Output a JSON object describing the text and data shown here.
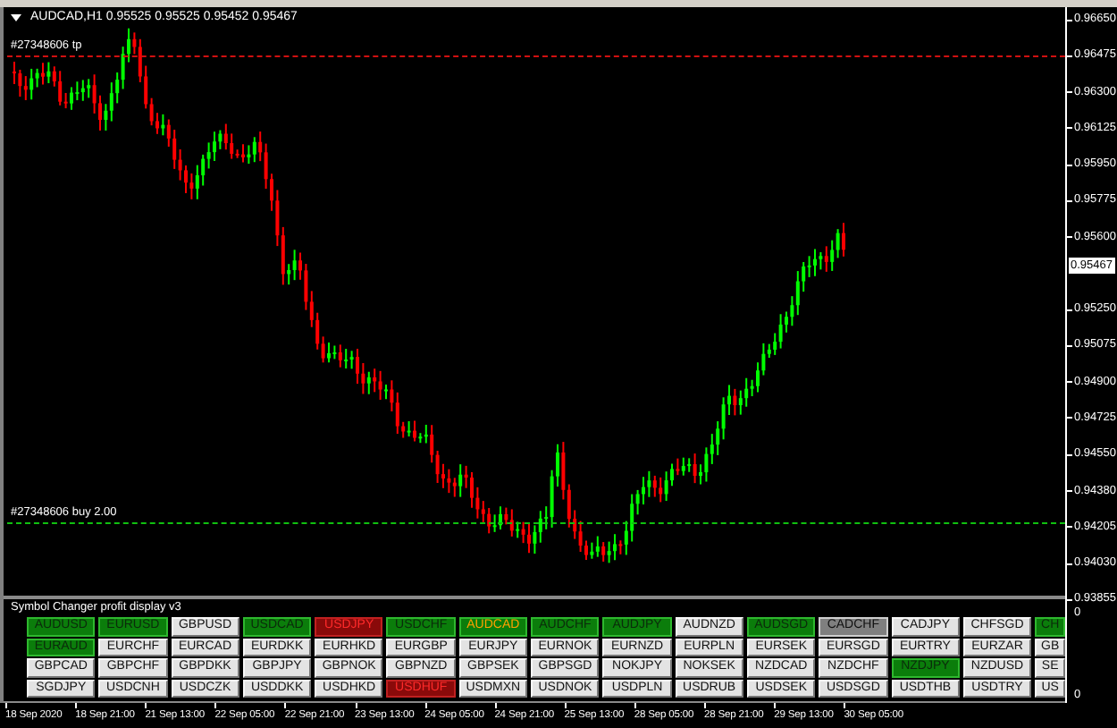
{
  "chart": {
    "title": "AUDCAD,H1  0.95525 0.95525 0.95452 0.95467",
    "orders": [
      {
        "kind": "tp",
        "label": "#27348606 tp"
      },
      {
        "kind": "entry",
        "label": "#27348606 buy 2.00"
      }
    ]
  },
  "price_axis": [
    {
      "kind": "tick",
      "label": "0.96650"
    },
    {
      "kind": "tick",
      "label": "0.96475"
    },
    {
      "kind": "tick",
      "label": "0.96300"
    },
    {
      "kind": "tick",
      "label": "0.96125"
    },
    {
      "kind": "tick",
      "label": "0.95950"
    },
    {
      "kind": "tick",
      "label": "0.95775"
    },
    {
      "kind": "tick",
      "label": "0.95600"
    },
    {
      "kind": "price",
      "label": "0.95467"
    },
    {
      "kind": "tick",
      "label": "0.95250"
    },
    {
      "kind": "tick",
      "label": "0.95075"
    },
    {
      "kind": "tick",
      "label": "0.94900"
    },
    {
      "kind": "tick",
      "label": "0.94725"
    },
    {
      "kind": "tick",
      "label": "0.94550"
    },
    {
      "kind": "tick",
      "label": "0.94380"
    },
    {
      "kind": "tick",
      "label": "0.94205"
    },
    {
      "kind": "tick",
      "label": "0.94030"
    },
    {
      "kind": "tick",
      "label": "0.93855"
    }
  ],
  "indicator": {
    "title": "Symbol Changer profit display v3",
    "axis": [
      "0",
      "0"
    ],
    "rows": [
      {
        "buttons": [
          {
            "symbol": "AUDUSD",
            "kind": "profit",
            "selected": false
          },
          {
            "symbol": "EURUSD",
            "kind": "profit",
            "selected": false
          },
          {
            "symbol": "GBPUSD",
            "kind": "flat",
            "selected": false
          },
          {
            "symbol": "USDCAD",
            "kind": "profit",
            "selected": false
          },
          {
            "symbol": "USDJPY",
            "kind": "loss",
            "selected": false
          },
          {
            "symbol": "USDCHF",
            "kind": "profit",
            "selected": false
          },
          {
            "symbol": "AUDCAD",
            "kind": "profit",
            "selected": true
          },
          {
            "symbol": "AUDCHF",
            "kind": "profit",
            "selected": false
          },
          {
            "symbol": "AUDJPY",
            "kind": "profit",
            "selected": false
          },
          {
            "symbol": "AUDNZD",
            "kind": "flat",
            "selected": false
          },
          {
            "symbol": "AUDSGD",
            "kind": "profit",
            "selected": false
          },
          {
            "symbol": "CADCHF",
            "kind": "closed",
            "selected": false
          },
          {
            "symbol": "CADJPY",
            "kind": "flat",
            "selected": false
          },
          {
            "symbol": "CHFSGD",
            "kind": "flat",
            "selected": false
          },
          {
            "symbol": "CH",
            "kind": "profit",
            "selected": false
          }
        ]
      },
      {
        "buttons": [
          {
            "symbol": "EURAUD",
            "kind": "profit",
            "selected": false
          },
          {
            "symbol": "EURCHF",
            "kind": "flat",
            "selected": false
          },
          {
            "symbol": "EURCAD",
            "kind": "flat",
            "selected": false
          },
          {
            "symbol": "EURDKK",
            "kind": "flat",
            "selected": false
          },
          {
            "symbol": "EURHKD",
            "kind": "flat",
            "selected": false
          },
          {
            "symbol": "EURGBP",
            "kind": "flat",
            "selected": false
          },
          {
            "symbol": "EURJPY",
            "kind": "flat",
            "selected": false
          },
          {
            "symbol": "EURNOK",
            "kind": "flat",
            "selected": false
          },
          {
            "symbol": "EURNZD",
            "kind": "flat",
            "selected": false
          },
          {
            "symbol": "EURPLN",
            "kind": "flat",
            "selected": false
          },
          {
            "symbol": "EURSEK",
            "kind": "flat",
            "selected": false
          },
          {
            "symbol": "EURSGD",
            "kind": "flat",
            "selected": false
          },
          {
            "symbol": "EURTRY",
            "kind": "flat",
            "selected": false
          },
          {
            "symbol": "EURZAR",
            "kind": "flat",
            "selected": false
          },
          {
            "symbol": "GB",
            "kind": "flat",
            "selected": false
          }
        ]
      },
      {
        "buttons": [
          {
            "symbol": "GBPCAD",
            "kind": "flat",
            "selected": false
          },
          {
            "symbol": "GBPCHF",
            "kind": "flat",
            "selected": false
          },
          {
            "symbol": "GBPDKK",
            "kind": "flat",
            "selected": false
          },
          {
            "symbol": "GBPJPY",
            "kind": "flat",
            "selected": false
          },
          {
            "symbol": "GBPNOK",
            "kind": "flat",
            "selected": false
          },
          {
            "symbol": "GBPNZD",
            "kind": "flat",
            "selected": false
          },
          {
            "symbol": "GBPSEK",
            "kind": "flat",
            "selected": false
          },
          {
            "symbol": "GBPSGD",
            "kind": "flat",
            "selected": false
          },
          {
            "symbol": "NOKJPY",
            "kind": "flat",
            "selected": false
          },
          {
            "symbol": "NOKSEK",
            "kind": "flat",
            "selected": false
          },
          {
            "symbol": "NZDCAD",
            "kind": "flat",
            "selected": false
          },
          {
            "symbol": "NZDCHF",
            "kind": "flat",
            "selected": false
          },
          {
            "symbol": "NZDJPY",
            "kind": "profit",
            "selected": false
          },
          {
            "symbol": "NZDUSD",
            "kind": "flat",
            "selected": false
          },
          {
            "symbol": "SE",
            "kind": "flat",
            "selected": false
          }
        ]
      },
      {
        "buttons": [
          {
            "symbol": "SGDJPY",
            "kind": "flat",
            "selected": false
          },
          {
            "symbol": "USDCNH",
            "kind": "flat",
            "selected": false
          },
          {
            "symbol": "USDCZK",
            "kind": "flat",
            "selected": false
          },
          {
            "symbol": "USDDKK",
            "kind": "flat",
            "selected": false
          },
          {
            "symbol": "USDHKD",
            "kind": "flat",
            "selected": false
          },
          {
            "symbol": "USDHUF",
            "kind": "loss",
            "selected": false
          },
          {
            "symbol": "USDMXN",
            "kind": "flat",
            "selected": false
          },
          {
            "symbol": "USDNOK",
            "kind": "flat",
            "selected": false
          },
          {
            "symbol": "USDPLN",
            "kind": "flat",
            "selected": false
          },
          {
            "symbol": "USDRUB",
            "kind": "flat",
            "selected": false
          },
          {
            "symbol": "USDSEK",
            "kind": "flat",
            "selected": false
          },
          {
            "symbol": "USDSGD",
            "kind": "flat",
            "selected": false
          },
          {
            "symbol": "USDTHB",
            "kind": "flat",
            "selected": false
          },
          {
            "symbol": "USDTRY",
            "kind": "flat",
            "selected": false
          },
          {
            "symbol": "US",
            "kind": "flat",
            "selected": false
          }
        ]
      }
    ]
  },
  "time_axis": [
    "18 Sep 2020",
    "18 Sep 21:00",
    "21 Sep 13:00",
    "22 Sep 05:00",
    "22 Sep 21:00",
    "23 Sep 13:00",
    "24 Sep 05:00",
    "24 Sep 21:00",
    "25 Sep 13:00",
    "28 Sep 05:00",
    "28 Sep 21:00",
    "29 Sep 13:00",
    "30 Sep 05:00"
  ]
}
